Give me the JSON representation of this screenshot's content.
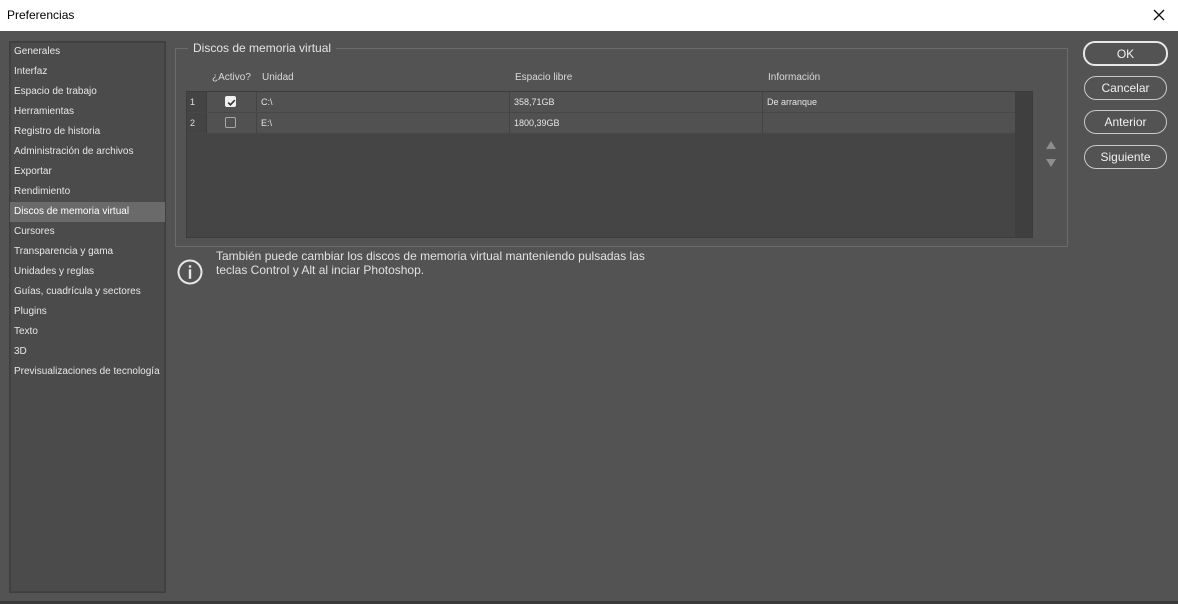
{
  "window": {
    "title": "Preferencias"
  },
  "sidebar": {
    "items": [
      {
        "label": "Generales"
      },
      {
        "label": "Interfaz"
      },
      {
        "label": "Espacio de trabajo"
      },
      {
        "label": "Herramientas"
      },
      {
        "label": "Registro de historia"
      },
      {
        "label": "Administración de archivos"
      },
      {
        "label": "Exportar"
      },
      {
        "label": "Rendimiento"
      },
      {
        "label": "Discos de memoria virtual",
        "selected": true
      },
      {
        "label": "Cursores"
      },
      {
        "label": "Transparencia y gama"
      },
      {
        "label": "Unidades y reglas"
      },
      {
        "label": "Guías, cuadrícula y sectores"
      },
      {
        "label": "Plugins"
      },
      {
        "label": "Texto"
      },
      {
        "label": "3D"
      },
      {
        "label": "Previsualizaciones de tecnología"
      }
    ]
  },
  "scratch": {
    "group_title": "Discos de memoria virtual",
    "columns": {
      "active": "¿Activo?",
      "drive": "Unidad",
      "free": "Espacio libre",
      "info": "Información"
    },
    "rows": [
      {
        "num": "1",
        "active": true,
        "drive": "C:\\",
        "free": "358,71GB",
        "info": "De arranque"
      },
      {
        "num": "2",
        "active": false,
        "drive": "E:\\",
        "free": "1800,39GB",
        "info": ""
      }
    ]
  },
  "info": {
    "text_line1": "También puede cambiar los discos de memoria virtual manteniendo pulsadas las",
    "text_line2": "teclas Control y Alt al inciar Photoshop."
  },
  "buttons": {
    "ok": "OK",
    "cancel": "Cancelar",
    "prev": "Anterior",
    "next": "Siguiente"
  },
  "icons": {
    "close": "close-icon",
    "info": "info-icon",
    "move_up": "triangle-up-icon",
    "move_down": "triangle-down-icon",
    "check": "checkmark-icon"
  },
  "colors": {
    "background": "#535353",
    "panel": "#4b4b4b",
    "selected": "#6a6a6a",
    "text": "#e8e8e8"
  }
}
